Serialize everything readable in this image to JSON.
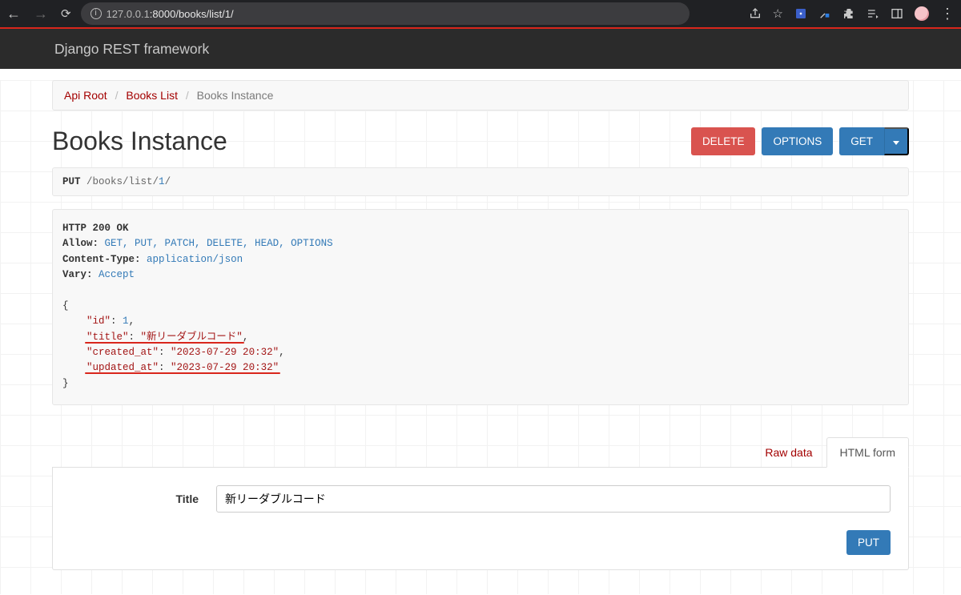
{
  "browser": {
    "url_host": "127.0.0.1",
    "url_port_path": ":8000/books/list/1/",
    "full_url": "127.0.0.1:8000/books/list/1/"
  },
  "navbar": {
    "brand": "Django REST framework"
  },
  "breadcrumb": {
    "root": "Api Root",
    "parent": "Books List",
    "current": "Books Instance"
  },
  "header": {
    "title": "Books Instance",
    "delete": "DELETE",
    "options": "OPTIONS",
    "get": "GET"
  },
  "request": {
    "method": "PUT",
    "path_prefix": " /books/list/",
    "path_id": "1",
    "path_suffix": "/"
  },
  "response": {
    "status_line": "HTTP 200 OK",
    "allow_label": "Allow:",
    "allow_value": "GET, PUT, PATCH, DELETE, HEAD, OPTIONS",
    "ctype_label": "Content-Type:",
    "ctype_value": "application/json",
    "vary_label": "Vary:",
    "vary_value": "Accept",
    "body": {
      "id_key": "\"id\"",
      "id_val": "1",
      "title_key": "\"title\"",
      "title_val": "\"新リーダブルコード\"",
      "created_key": "\"created_at\"",
      "created_val": "\"2023-07-29 20:32\"",
      "updated_key": "\"updated_at\"",
      "updated_val": "\"2023-07-29 20:32\""
    }
  },
  "tabs": {
    "raw": "Raw data",
    "html": "HTML form"
  },
  "form": {
    "title_label": "Title",
    "title_value": "新リーダブルコード",
    "submit": "PUT"
  }
}
